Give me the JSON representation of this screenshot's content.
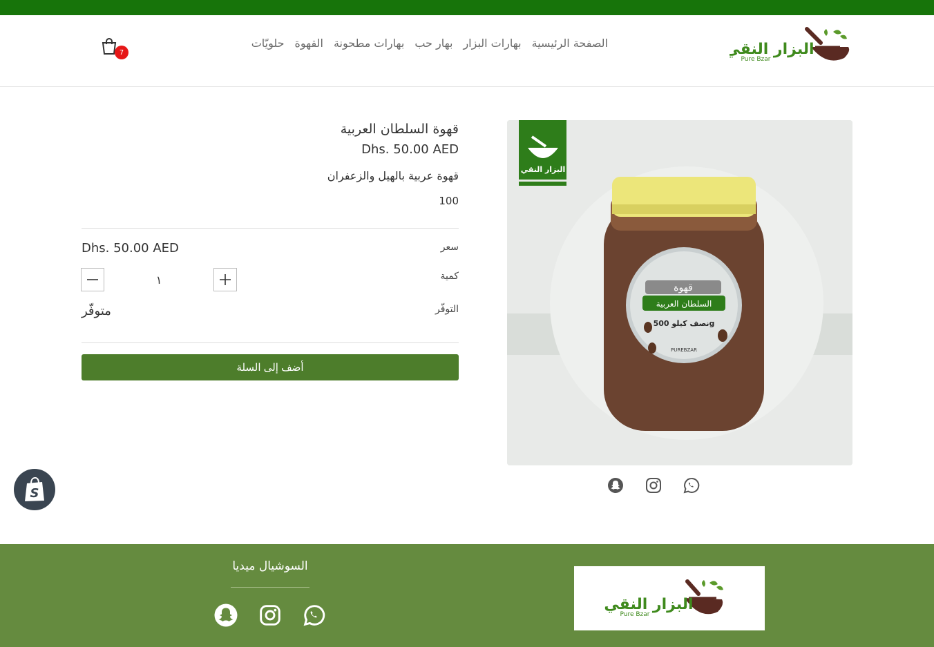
{
  "header": {
    "cart_count": "7",
    "nav": [
      "الصفحة الرئيسية",
      "بهارات البزار",
      "بهار حب",
      "بهارات مطحونة",
      "القهوة",
      "حلويّات"
    ],
    "logo_text_ar": "البزار النقي",
    "logo_text_en": "Pure Bzar"
  },
  "product": {
    "title": "قهوة السلطان العربية",
    "price": "Dhs. 50.00 AED",
    "description": "قهوة عربية بالهيل والزعفران",
    "weight": "100",
    "price_label": "سعر",
    "price_value": "Dhs. 50.00 AED",
    "quantity_label": "كمية",
    "quantity_value": "١",
    "availability_label": "التوفّر",
    "availability_value": "متوفّر",
    "add_to_cart": "أضف إلى السلة",
    "jar_label_top": "قهوة",
    "jar_label_main": "السلطان العربية",
    "jar_label_weight": "نصف كيلو 500g",
    "jar_brand": "PUREBZAR"
  },
  "footer": {
    "social_title": "السوشيال ميديا",
    "logo_text_ar": "البزار النقي",
    "logo_text_en": "Pure Bzar"
  },
  "colors": {
    "topbar": "#17740a",
    "button": "#4d7d2b",
    "footer": "#658b3f",
    "badge": "#e61717"
  }
}
